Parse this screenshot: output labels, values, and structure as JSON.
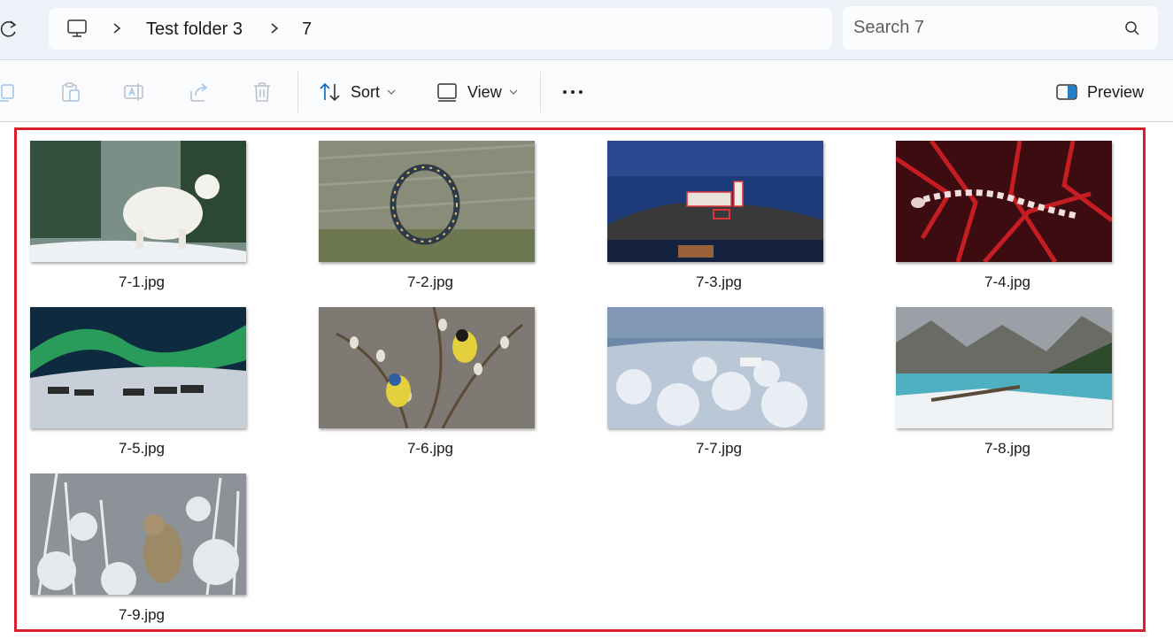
{
  "breadcrumb": {
    "items": [
      "Test folder 3",
      "7"
    ]
  },
  "search": {
    "placeholder": "Search 7"
  },
  "toolbar": {
    "sort_label": "Sort",
    "view_label": "View",
    "preview_label": "Preview",
    "icons": [
      "copy-icon",
      "paste-icon",
      "rename-icon",
      "share-icon",
      "delete-icon",
      "sort-icon",
      "view-icon",
      "more-icon",
      "preview-pane-icon"
    ]
  },
  "files": [
    {
      "name": "7-1.jpg"
    },
    {
      "name": "7-2.jpg"
    },
    {
      "name": "7-3.jpg"
    },
    {
      "name": "7-4.jpg"
    },
    {
      "name": "7-5.jpg"
    },
    {
      "name": "7-6.jpg"
    },
    {
      "name": "7-7.jpg"
    },
    {
      "name": "7-8.jpg"
    },
    {
      "name": "7-9.jpg"
    }
  ],
  "colors": {
    "highlight": "#d8202f",
    "topbar": "#eef2f8",
    "accent": "#0067c0"
  }
}
